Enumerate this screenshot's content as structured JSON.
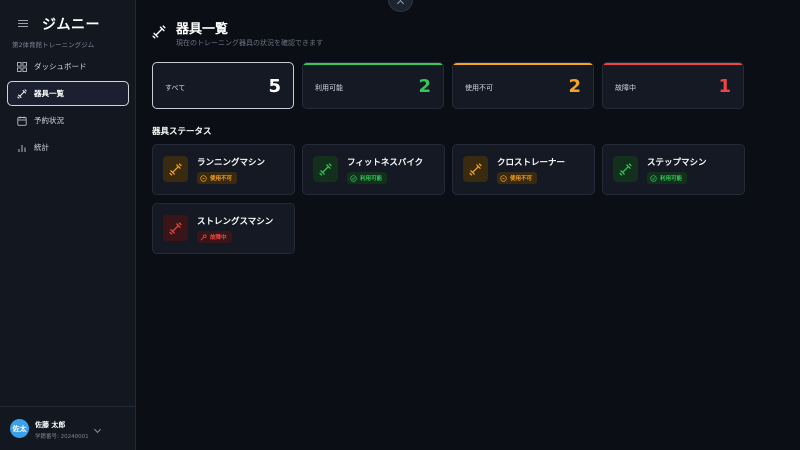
{
  "app": {
    "title": "ジムニー",
    "gym_name": "第2体育館トレーニングジム"
  },
  "sidebar": {
    "items": [
      {
        "label": "ダッシュボード",
        "icon": "dashboard-icon",
        "active": false
      },
      {
        "label": "器具一覧",
        "icon": "dumbbell-icon",
        "active": true
      },
      {
        "label": "予約状況",
        "icon": "calendar-icon",
        "active": false
      },
      {
        "label": "統計",
        "icon": "bar-chart-icon",
        "active": false
      }
    ]
  },
  "user": {
    "avatar_text": "佐太",
    "name": "佐藤 太郎",
    "id": "学籍番号: 20240001"
  },
  "page": {
    "title": "器具一覧",
    "subtitle": "現在のトレーニング器具の状況を確認できます"
  },
  "summary": [
    {
      "label": "すべて",
      "count": "5",
      "accent": "#ffffff"
    },
    {
      "label": "利用可能",
      "count": "2",
      "accent": "#34c759"
    },
    {
      "label": "使用不可",
      "count": "2",
      "accent": "#f5a524"
    },
    {
      "label": "故障中",
      "count": "1",
      "accent": "#ef4444"
    }
  ],
  "section": {
    "title": "器具ステータス"
  },
  "equipment": [
    {
      "name": "ランニングマシン",
      "status": "使用不可",
      "status_icon": "clock-icon",
      "color": "#f5a524"
    },
    {
      "name": "フィットネスバイク",
      "status": "利用可能",
      "status_icon": "check-circle-icon",
      "color": "#34c759"
    },
    {
      "name": "クロストレーナー",
      "status": "使用不可",
      "status_icon": "clock-icon",
      "color": "#f5a524"
    },
    {
      "name": "ステップマシン",
      "status": "利用可能",
      "status_icon": "check-circle-icon",
      "color": "#34c759"
    },
    {
      "name": "ストレングスマシン",
      "status": "故障中",
      "status_icon": "wrench-icon",
      "color": "#ef4444"
    }
  ]
}
